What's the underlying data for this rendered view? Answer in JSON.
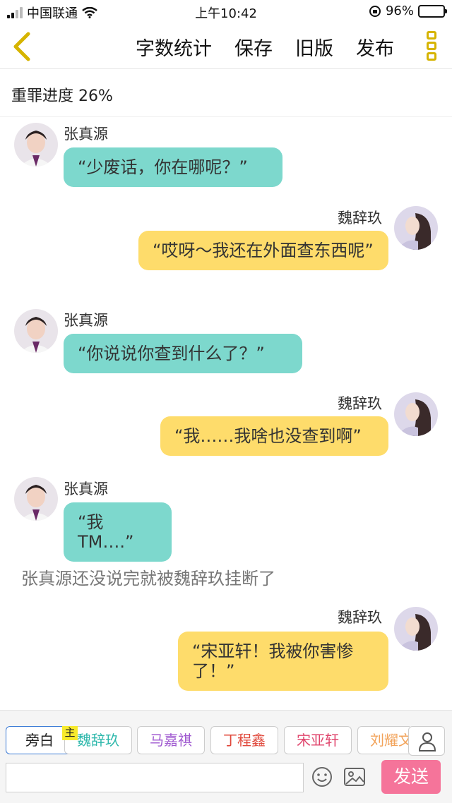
{
  "status_bar": {
    "carrier": "中国联通",
    "time": "上午10:42",
    "battery": "96%",
    "battery_level": 0.96
  },
  "nav": {
    "word_count": "字数统计",
    "save": "保存",
    "old_version": "旧版",
    "publish": "发布"
  },
  "progress": {
    "label": "重罪进度 26%"
  },
  "messages": [
    {
      "speaker": "张真源",
      "text": "“少废话，你在哪呢？”",
      "side": "left"
    },
    {
      "speaker": "魏辞玖",
      "text": "“哎呀～我还在外面查东西呢”",
      "side": "right"
    },
    {
      "speaker": "张真源",
      "text": "“你说说你查到什么了？”",
      "side": "left"
    },
    {
      "speaker": "魏辞玖",
      "text": "“我……我啥也没查到啊”",
      "side": "right"
    },
    {
      "speaker": "张真源",
      "text": "“我 TM….”",
      "side": "left"
    },
    {
      "narration": "张真源还没说完就被魏辞玖挂断了"
    },
    {
      "speaker": "魏辞玖",
      "text": "“宋亚轩！我被你害惨了！”",
      "side": "right"
    }
  ],
  "characters": [
    {
      "label": "旁白",
      "color": "#222222"
    },
    {
      "label": "魏辞玖",
      "color": "#2fb8ac",
      "tag": "主"
    },
    {
      "label": "马嘉祺",
      "color": "#a05ad0"
    },
    {
      "label": "丁程鑫",
      "color": "#e0473a"
    },
    {
      "label": "宋亚轩",
      "color": "#e0476e"
    },
    {
      "label": "刘耀文",
      "color": "#f2a35a"
    }
  ],
  "composer": {
    "input_value": "",
    "send": "发送"
  },
  "colors": {
    "teal_bubble": "#7dd8cd",
    "yellow_bubble": "#fedc6b",
    "send_button": "#f5749a",
    "accent": "#d6b400"
  }
}
